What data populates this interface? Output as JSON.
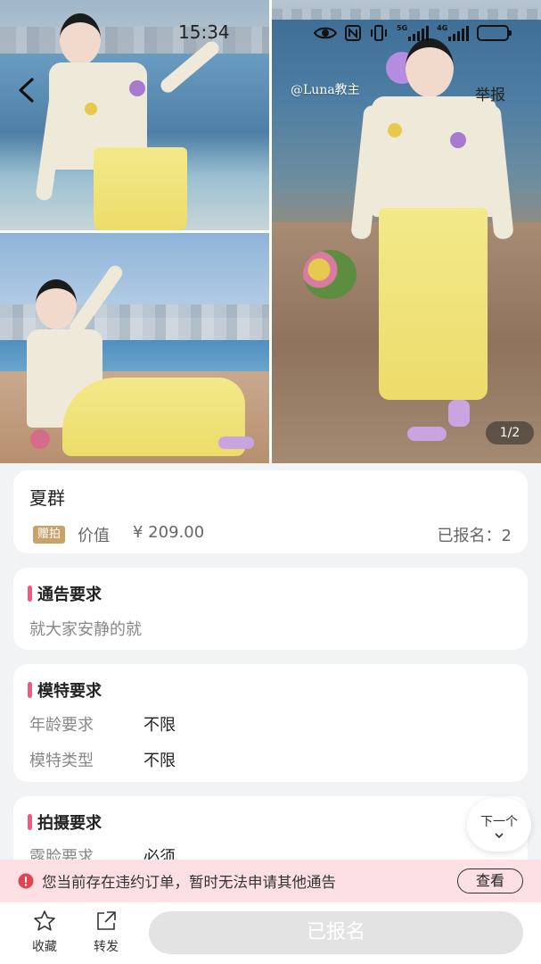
{
  "status_bar": {
    "time": "15:34",
    "network_badges": [
      "5G",
      "4G"
    ],
    "icons": [
      "eye-icon",
      "nfc-icon",
      "vibrate-icon",
      "signal-5g-icon",
      "signal-4g-icon",
      "battery-icon"
    ],
    "battery_level": 0.8
  },
  "gallery": {
    "watermark": "@Luna教主",
    "report_label": "举报",
    "page_indicator": "1/2",
    "back_icon": "back-arrow-icon"
  },
  "event": {
    "title": "夏群",
    "gift_badge": "赠拍",
    "value_label": "价值",
    "value_amount": "¥ 209.00",
    "signup_count": "已报名：2"
  },
  "sections": {
    "notice": {
      "title": "通告要求",
      "text": "就大家安静的就"
    },
    "model": {
      "title": "模特要求",
      "rows": [
        {
          "key": "年龄要求",
          "value": "不限"
        },
        {
          "key": "模特类型",
          "value": "不限"
        }
      ]
    },
    "shoot": {
      "title": "拍摄要求",
      "rows": [
        {
          "key": "露脸要求",
          "value": "必须"
        }
      ]
    }
  },
  "next_button": {
    "label": "下一个",
    "icon": "chevron-down-icon"
  },
  "warning": {
    "text": "您当前存在违约订单，暂时无法申请其他通告",
    "button_label": "查看",
    "icon": "alert-icon"
  },
  "bottom_bar": {
    "favorite_label": "收藏",
    "share_label": "转发",
    "signed_label": "已报名"
  },
  "colors": {
    "accent_pink": "#f05a7e",
    "warning_bg": "#fde0e3",
    "gift_badge": "#c9a26a",
    "disabled_button": "#e3e3e3"
  }
}
